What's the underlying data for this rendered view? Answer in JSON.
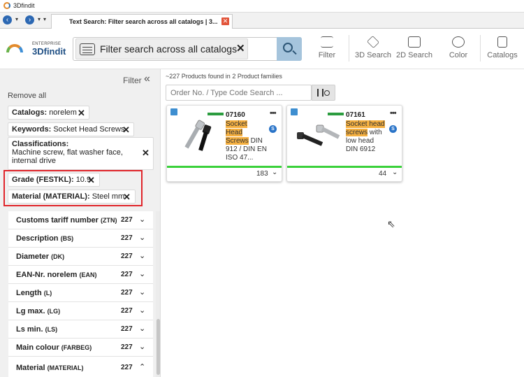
{
  "window": {
    "title": "3Dfindit"
  },
  "tab": {
    "title": "Text Search: Filter search across all catalogs | 3...",
    "close_glyph": "✕"
  },
  "brand": {
    "sub": "ENTERPRISE",
    "name": "3Dfindit"
  },
  "search": {
    "chip_text": "Filter search across all catalogs",
    "chip_close": "✕"
  },
  "toolbar": {
    "filter": "Filter",
    "search3d": "3D Search",
    "search2d": "2D Search",
    "color": "Color",
    "catalogs": "Catalogs"
  },
  "sidebar": {
    "filter_label": "Filter",
    "collapse_glyph": "«",
    "remove_all": "Remove all",
    "chips": {
      "catalogs": {
        "key": "Catalogs:",
        "value": "norelem"
      },
      "keywords": {
        "key": "Keywords:",
        "value": "Socket Head Screws"
      },
      "classifications": {
        "key": "Classifications:",
        "value": "Machine screw, flat washer face, internal drive"
      },
      "grade": {
        "key": "Grade (FESTKL):",
        "value": "10.9"
      },
      "material": {
        "key": "Material (MATERIAL):",
        "value": "Steel mm"
      }
    },
    "accordion": [
      {
        "name": "Customs tariff number",
        "code": "(ZTN)",
        "count": "227",
        "chevron": "⌄"
      },
      {
        "name": "Description",
        "code": "(BS)",
        "count": "227",
        "chevron": "⌄"
      },
      {
        "name": "Diameter",
        "code": "(DK)",
        "count": "227",
        "chevron": "⌄"
      },
      {
        "name": "EAN-Nr. norelem",
        "code": "(EAN)",
        "count": "227",
        "chevron": "⌄"
      },
      {
        "name": "Length",
        "code": "(L)",
        "count": "227",
        "chevron": "⌄"
      },
      {
        "name": "Lg max.",
        "code": "(LG)",
        "count": "227",
        "chevron": "⌄"
      },
      {
        "name": "Ls min.",
        "code": "(LS)",
        "count": "227",
        "chevron": "⌄"
      },
      {
        "name": "Main colour",
        "code": "(FARBEG)",
        "count": "227",
        "chevron": "⌄"
      },
      {
        "name": "Material",
        "code": "(MATERIAL)",
        "count": "227",
        "chevron": "⌃"
      }
    ]
  },
  "results": {
    "count_text": "~227 Products found in 2 Product families",
    "order_placeholder": "Order No. / Type Code Search ...",
    "cards": [
      {
        "number": "07160",
        "highlight": [
          "Socket",
          "Head",
          "Screws"
        ],
        "rest": "DIN 912 / DIN EN ISO 47...",
        "count": "183",
        "badge": "S"
      },
      {
        "number": "07161",
        "highlight": [
          "Socket head",
          "screws"
        ],
        "rest": "with low head DIN 6912",
        "count": "44",
        "badge": "S"
      }
    ]
  }
}
